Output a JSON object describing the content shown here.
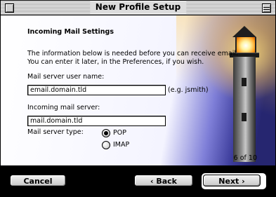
{
  "window": {
    "title": "New Profile Setup"
  },
  "page": {
    "heading": "Incoming Mail Settings",
    "intro_line1": "The information below is needed before you can receive email.",
    "intro_line2": "You can enter it later, in the Preferences, if you wish.",
    "user_name_label": "Mail server user name:",
    "user_name_value": "email.domain.tld",
    "user_name_hint": "(e.g. jsmith)",
    "incoming_server_label": "Incoming mail server:",
    "incoming_server_value": "mail.domain.tld",
    "server_type_label": "Mail server type:",
    "server_types": [
      {
        "label": "POP",
        "selected": true
      },
      {
        "label": "IMAP",
        "selected": false
      }
    ],
    "step_indicator": "6 of 10"
  },
  "buttons": {
    "cancel": "Cancel",
    "back": "‹ Back",
    "next": "Next ›"
  },
  "icons": {
    "close_box": "close-icon",
    "collapse_box": "collapse-icon",
    "illustration": "lighthouse-illustration"
  }
}
